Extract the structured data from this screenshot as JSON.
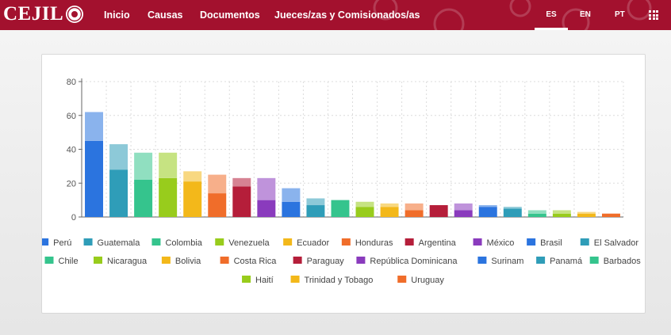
{
  "header": {
    "logo_text": "CEJIL",
    "nav": [
      "Inicio",
      "Causas",
      "Documentos",
      "Jueces/zas y Comisionados/as"
    ],
    "languages": [
      "ES",
      "EN",
      "PT"
    ],
    "active_language": "ES",
    "brand_color": "#a3112e"
  },
  "chart_data": {
    "type": "bar",
    "stacked": true,
    "grid": true,
    "legend_position": "bottom",
    "ylim": [
      0,
      80
    ],
    "yticks": [
      0,
      20,
      40,
      60,
      80
    ],
    "categories": [
      "Perú",
      "Guatemala",
      "Colombia",
      "Venezuela",
      "Ecuador",
      "Honduras",
      "Argentina",
      "México",
      "Brasil",
      "El Salvador",
      "Chile",
      "Nicaragua",
      "Bolivia",
      "Costa Rica",
      "Paraguay",
      "República Dominicana",
      "Surinam",
      "Panamá",
      "Barbados",
      "Haití",
      "Trinidad y Tobago",
      "Uruguay"
    ],
    "colors": [
      "#2b74df",
      "#2f9db8",
      "#35c48d",
      "#98cc1c",
      "#f3b81a",
      "#f06d2a",
      "#b51e3a",
      "#8a3bbd",
      "#2b74df",
      "#2f9db8",
      "#35c48d",
      "#98cc1c",
      "#f3b81a",
      "#f06d2a",
      "#b51e3a",
      "#8a3bbd",
      "#2b74df",
      "#2f9db8",
      "#35c48d",
      "#98cc1c",
      "#f3b81a",
      "#f06d2a"
    ],
    "series": [
      {
        "values": [
          45,
          28,
          22,
          23,
          21,
          14,
          18,
          10,
          9,
          7,
          10,
          6,
          6,
          4,
          7,
          4,
          6,
          5,
          2,
          2,
          2,
          2
        ]
      },
      {
        "values": [
          17,
          15,
          16,
          15,
          6,
          11,
          5,
          13,
          8,
          4,
          0,
          3,
          2,
          4,
          0,
          4,
          1,
          1,
          2,
          2,
          1,
          0
        ]
      }
    ]
  }
}
